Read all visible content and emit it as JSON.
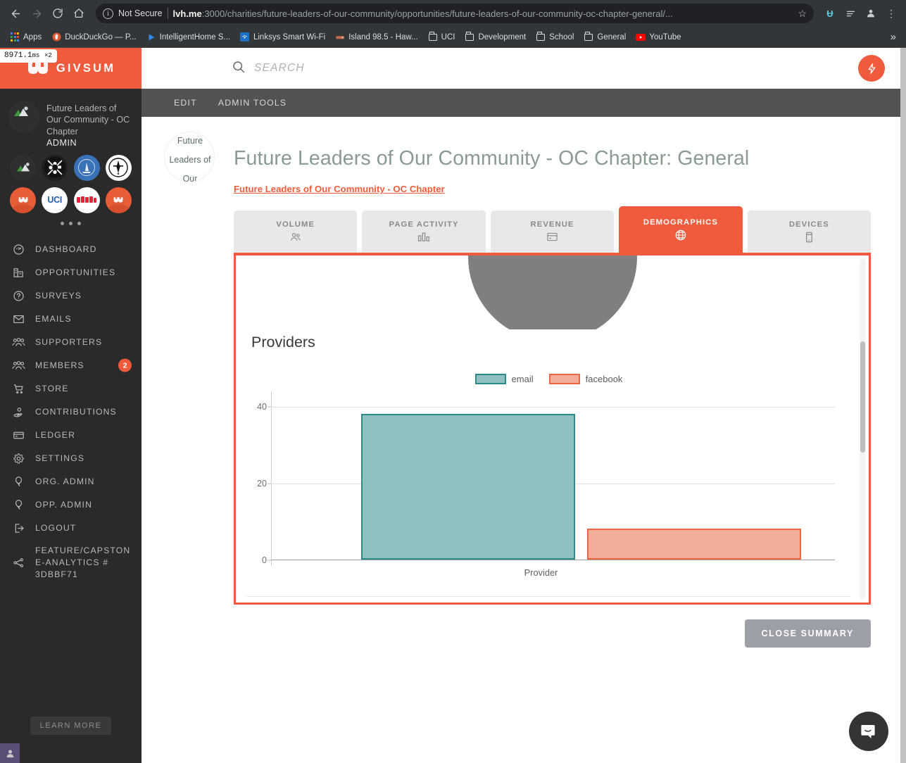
{
  "browser": {
    "nav": {
      "back": "←",
      "forward": "→",
      "reload": "⟳",
      "home": "⌂"
    },
    "security_label": "Not Secure",
    "url_host": "lvh.me",
    "url_path": ":3000/charities/future-leaders-of-our-community/opportunities/future-leaders-of-our-community-oc-chapter-general/...",
    "bookmarks": [
      {
        "label": "Apps",
        "icon": "apps-grid-icon"
      },
      {
        "label": "DuckDuckGo — P...",
        "icon": "duckduckgo-icon"
      },
      {
        "label": "IntelligentHome S...",
        "icon": "play-icon"
      },
      {
        "label": "Linksys Smart Wi-Fi",
        "icon": "wifi-icon"
      },
      {
        "label": "Island 98.5 - Haw...",
        "icon": "radio-icon"
      },
      {
        "label": "UCI",
        "icon": "folder-icon"
      },
      {
        "label": "Development",
        "icon": "folder-icon"
      },
      {
        "label": "School",
        "icon": "folder-icon"
      },
      {
        "label": "General",
        "icon": "folder-icon"
      },
      {
        "label": "YouTube",
        "icon": "youtube-icon"
      }
    ],
    "overflow": "»"
  },
  "perf_badge": {
    "value": "8971.1",
    "unit": "ms",
    "count": "×2"
  },
  "sidebar": {
    "brand": "GIVSUM",
    "org_name": "Future Leaders of Our Community - OC Chapter",
    "org_role": "ADMIN",
    "org_chips": [
      {
        "name": "future-leaders",
        "type": "photo"
      },
      {
        "name": "dark-crest",
        "type": "dark"
      },
      {
        "name": "blue-seal",
        "type": "blue"
      },
      {
        "name": "black-white-crest",
        "type": "white"
      },
      {
        "name": "givsum-orange-a",
        "type": "givsum"
      },
      {
        "name": "uci",
        "type": "white",
        "text": "UCI"
      },
      {
        "name": "red-logo",
        "type": "white"
      },
      {
        "name": "givsum-orange-b",
        "type": "givsum"
      }
    ],
    "items": [
      {
        "label": "DASHBOARD",
        "icon": "gauge-icon"
      },
      {
        "label": "OPPORTUNITIES",
        "icon": "buildings-icon"
      },
      {
        "label": "SURVEYS",
        "icon": "question-circle-icon"
      },
      {
        "label": "EMAILS",
        "icon": "envelope-icon"
      },
      {
        "label": "SUPPORTERS",
        "icon": "people-icon"
      },
      {
        "label": "MEMBERS",
        "icon": "people-icon",
        "badge": "2"
      },
      {
        "label": "STORE",
        "icon": "cart-icon"
      },
      {
        "label": "CONTRIBUTIONS",
        "icon": "hand-heart-icon"
      },
      {
        "label": "LEDGER",
        "icon": "card-icon"
      },
      {
        "label": "SETTINGS",
        "icon": "gear-icon"
      },
      {
        "label": "ORG. ADMIN",
        "icon": "balloon-icon"
      },
      {
        "label": "OPP. ADMIN",
        "icon": "balloon-icon"
      },
      {
        "label": "LOGOUT",
        "icon": "logout-icon"
      },
      {
        "label": "FEATURE/CAPSTONE-ANALYTICS # 3DBBF71",
        "icon": "branch-icon"
      }
    ],
    "learn_more": "LEARN MORE"
  },
  "topbar": {
    "search_placeholder": "SEARCH",
    "search_value": "",
    "bolt_label": "bolt-icon"
  },
  "subbar": {
    "edit": "EDIT",
    "admin_tools": "ADMIN TOOLS"
  },
  "header": {
    "logo_text": "Future Leaders of Our",
    "title": "Future Leaders of Our Community - OC Chapter: General",
    "parent_link": "Future Leaders of Our Community - OC Chapter"
  },
  "tabs": [
    {
      "label": "VOLUME",
      "icon": "people-icon",
      "active": false
    },
    {
      "label": "PAGE ACTIVITY",
      "icon": "bar-chart-icon",
      "active": false
    },
    {
      "label": "REVENUE",
      "icon": "card-icon",
      "active": false
    },
    {
      "label": "DEMOGRAPHICS",
      "icon": "globe-icon",
      "active": true
    },
    {
      "label": "DEVICES",
      "icon": "mobile-icon",
      "active": false
    }
  ],
  "panel": {
    "providers_title": "Providers",
    "close_summary": "CLOSE SUMMARY"
  },
  "chart_data": {
    "type": "bar",
    "title": "Providers",
    "categories": [
      "Provider"
    ],
    "xlabel": "Provider",
    "ylabel": "",
    "ylim": [
      0,
      44
    ],
    "yticks": [
      0,
      20,
      40
    ],
    "grid": true,
    "legend_position": "top-center",
    "series": [
      {
        "name": "email",
        "values": [
          38
        ],
        "color": "#8dc0bf",
        "border": "#2e8b8b"
      },
      {
        "name": "facebook",
        "values": [
          8
        ],
        "color": "#f4ad98",
        "border": "#ef6644"
      }
    ]
  },
  "colors": {
    "accent": "#ef5b3c",
    "sidebar_bg": "#2a2a2a",
    "subbar_bg": "#545251",
    "title_text": "#8a9b92",
    "email_fill": "#8dc0bf",
    "email_border": "#2e8b8b",
    "facebook_fill": "#f4ad98",
    "facebook_border": "#ef6644",
    "close_button": "#9c9fa6"
  },
  "chat": {
    "icon": "chat-bubble-icon"
  }
}
